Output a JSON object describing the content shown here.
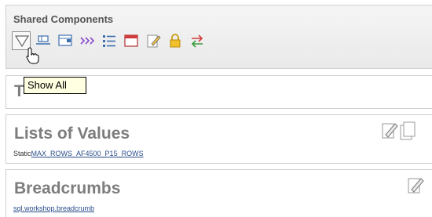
{
  "shared": {
    "title": "Shared Components",
    "toolbar": [
      {
        "icon": "filter-icon",
        "tooltip": "Show All",
        "active": true
      },
      {
        "icon": "tabs-icon"
      },
      {
        "icon": "list-of-values-icon"
      },
      {
        "icon": "breadcrumbs-icon"
      },
      {
        "icon": "lists-icon"
      },
      {
        "icon": "window-icon"
      },
      {
        "icon": "edit-icon"
      },
      {
        "icon": "lock-icon"
      },
      {
        "icon": "swap-icon"
      }
    ]
  },
  "tooltip": {
    "text": "Show All"
  },
  "panels": [
    {
      "title_partial": "T"
    },
    {
      "title": "Lists of Values",
      "sub_prefix": "Static",
      "sub_link": "MAX_ROWS_AF4500_P15_ROWS",
      "icons": [
        "edit-icon",
        "copy-icon"
      ]
    },
    {
      "title": "Breadcrumbs",
      "sub_link": "sql.workshop.breadcrumb",
      "icons": [
        "edit-icon"
      ]
    }
  ],
  "colors": {
    "tooltip_bg": "#ffffe1",
    "link": "#2a4d8a",
    "heading": "#7d7d7d"
  }
}
